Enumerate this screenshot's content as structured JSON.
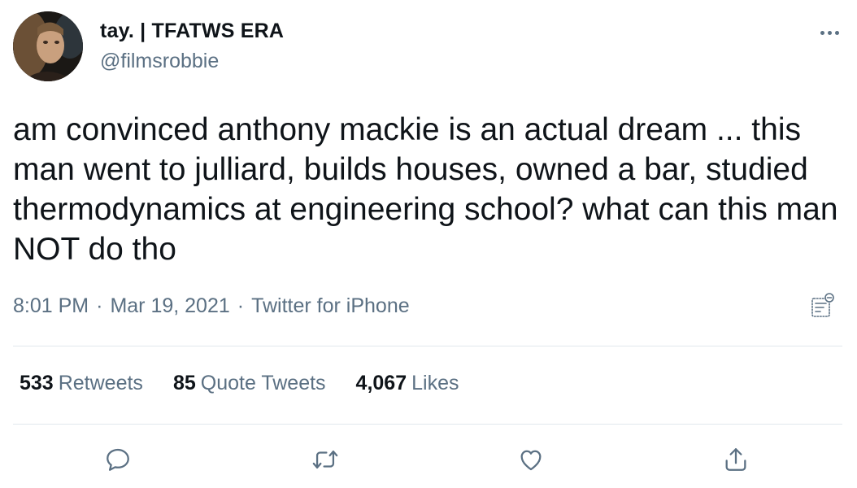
{
  "tweet": {
    "display_name": "tay. | TFATWS ERA",
    "handle": "@filmsrobbie",
    "text": "am convinced anthony mackie is an actual dream ... this man went to julliard, builds houses, owned a bar, studied thermodynamics at engineering school? what can this man NOT do tho",
    "time": "8:01 PM",
    "separator": "·",
    "date": "Mar 19, 2021",
    "source": "Twitter for iPhone"
  },
  "stats": {
    "retweets_count": "533",
    "retweets_label": "Retweets",
    "quotes_count": "85",
    "quotes_label": "Quote Tweets",
    "likes_count": "4,067",
    "likes_label": "Likes"
  },
  "icons": {
    "more": "more-icon",
    "analytics": "analytics-icon",
    "reply": "reply-icon",
    "retweet": "retweet-icon",
    "like": "like-icon",
    "share": "share-icon"
  },
  "colors": {
    "text_primary": "#0f1419",
    "text_secondary": "#5b7083",
    "divider": "#e1e8ed"
  }
}
